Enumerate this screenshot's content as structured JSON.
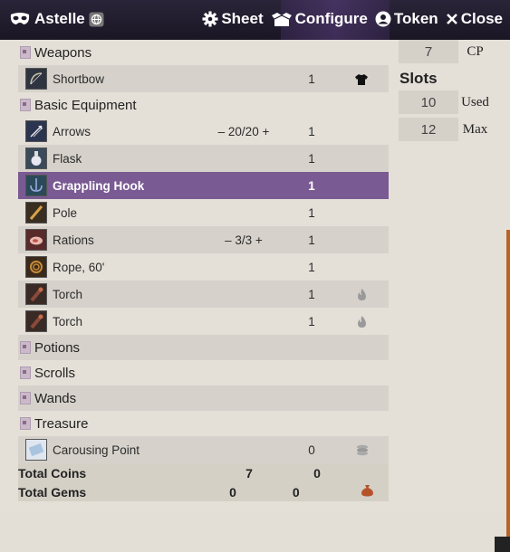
{
  "window": {
    "title": "Astelle",
    "buttons": {
      "sheet": "Sheet",
      "configure": "Configure",
      "token": "Token",
      "close": "Close"
    }
  },
  "inventory": {
    "categories": {
      "weapons": "Weapons",
      "basic_equipment": "Basic Equipment",
      "potions": "Potions",
      "scrolls": "Scrolls",
      "wands": "Wands",
      "treasure": "Treasure"
    },
    "items": {
      "shortbow": {
        "name": "Shortbow",
        "count": "1"
      },
      "arrows": {
        "name": "Arrows",
        "uses": "– 20/20 +",
        "count": "1"
      },
      "flask": {
        "name": "Flask",
        "count": "1"
      },
      "grappling_hook": {
        "name": "Grappling Hook",
        "count": "1"
      },
      "pole": {
        "name": "Pole",
        "count": "1"
      },
      "rations": {
        "name": "Rations",
        "uses": "– 3/3 +",
        "count": "1"
      },
      "rope": {
        "name": "Rope, 60'",
        "count": "1"
      },
      "torch1": {
        "name": "Torch",
        "count": "1"
      },
      "torch2": {
        "name": "Torch",
        "count": "1"
      },
      "carousing_point": {
        "name": "Carousing Point",
        "count": "0"
      }
    },
    "totals": {
      "coins": {
        "label": "Total Coins",
        "value": "7",
        "weight": "0"
      },
      "gems": {
        "label": "Total Gems",
        "value": "0",
        "weight": "0"
      }
    }
  },
  "side_panel": {
    "cp": {
      "value": "7",
      "label": "CP"
    },
    "slots_heading": "Slots",
    "used": {
      "value": "10",
      "label": "Used"
    },
    "max": {
      "value": "12",
      "label": "Max"
    }
  },
  "colors": {
    "selected_row": "#7a5a92",
    "header_bg": "#1f1a2b",
    "background": "#e4e0d8"
  }
}
